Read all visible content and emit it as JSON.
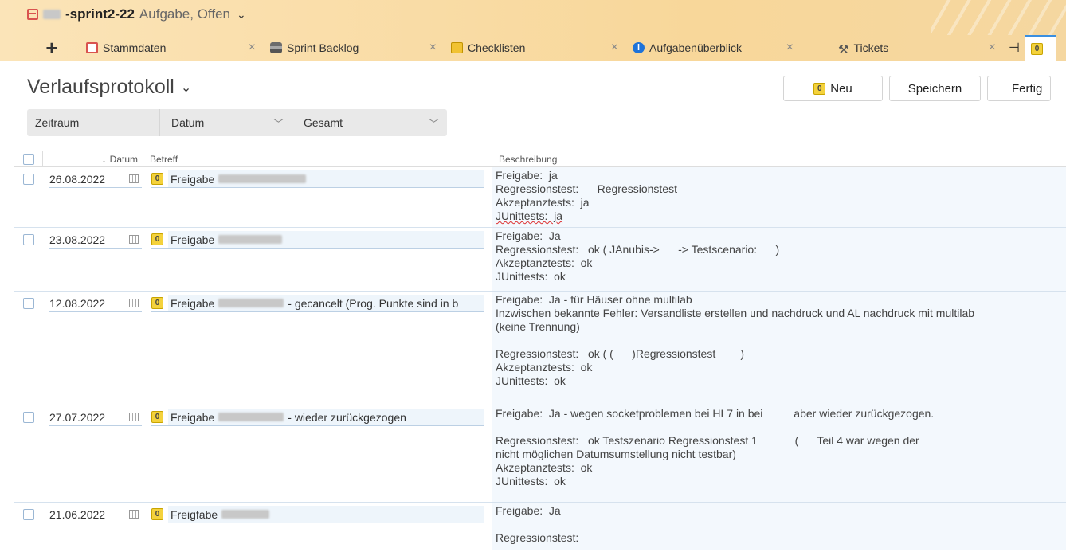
{
  "window": {
    "title_bold": "-sprint2-22",
    "title_rest": "Aufgabe, Offen"
  },
  "tabs": [
    {
      "label": "Stammdaten",
      "icon": "stammdaten-icon"
    },
    {
      "label": "Sprint Backlog",
      "icon": "sprint-backlog-icon"
    },
    {
      "label": "Checklisten",
      "icon": "checklist-icon"
    },
    {
      "label": "Aufgabenüberblick",
      "icon": "info-icon"
    },
    {
      "label": "Tickets",
      "icon": "tickets-icon"
    }
  ],
  "page": {
    "title": "Verlaufsprotokoll"
  },
  "actions": {
    "new_label": "Neu",
    "save_label": "Speichern",
    "done_label": "Fertig"
  },
  "filter": {
    "zeitraum": "Zeitraum",
    "datum": "Datum",
    "gesamt": "Gesamt"
  },
  "table": {
    "columns": {
      "date": "Datum",
      "subject": "Betreff",
      "description": "Beschreibung"
    },
    "rows": [
      {
        "date": "26.08.2022",
        "subject": "Freigabe",
        "subject_suffix": "",
        "desc": [
          "Freigabe:  ja",
          "Regressionstest:      Regressionstest",
          "Akzeptanztests:  ja",
          "JUnittests:  ja"
        ]
      },
      {
        "date": "23.08.2022",
        "subject": "Freigabe",
        "subject_suffix": "",
        "desc": [
          "Freigabe:  Ja",
          "Regressionstest:   ok ( JAnubis->      -> Testscenario:      )",
          "Akzeptanztests:  ok",
          "JUnittests:  ok"
        ]
      },
      {
        "date": "12.08.2022",
        "subject": "Freigabe",
        "subject_suffix": "- gecancelt (Prog. Punkte sind in b",
        "desc": [
          "Freigabe:  Ja - für Häuser ohne multilab",
          "Inzwischen bekannte Fehler: Versandliste erstellen und nachdruck und AL nachdruck mit multilab",
          "(keine Trennung)",
          "",
          "Regressionstest:   ok ( (      )Regressionstest        )",
          "Akzeptanztests:  ok",
          "JUnittests:  ok"
        ]
      },
      {
        "date": "27.07.2022",
        "subject": "Freigabe",
        "subject_suffix": "- wieder zurückgezogen",
        "desc": [
          "Freigabe:  Ja - wegen socketproblemen bei HL7 in bei          aber wieder zurückgezogen.",
          "",
          "Regressionstest:   ok Testszenario Regressionstest 1            (      Teil 4 war wegen der",
          "nicht möglichen Datumsumstellung nicht testbar)",
          "Akzeptanztests:  ok",
          "JUnittests:  ok"
        ]
      },
      {
        "date": "21.06.2022",
        "subject": "Freigfabe",
        "subject_suffix": "",
        "desc": [
          "Freigabe:  Ja",
          "",
          "Regressionstest:"
        ]
      }
    ]
  }
}
